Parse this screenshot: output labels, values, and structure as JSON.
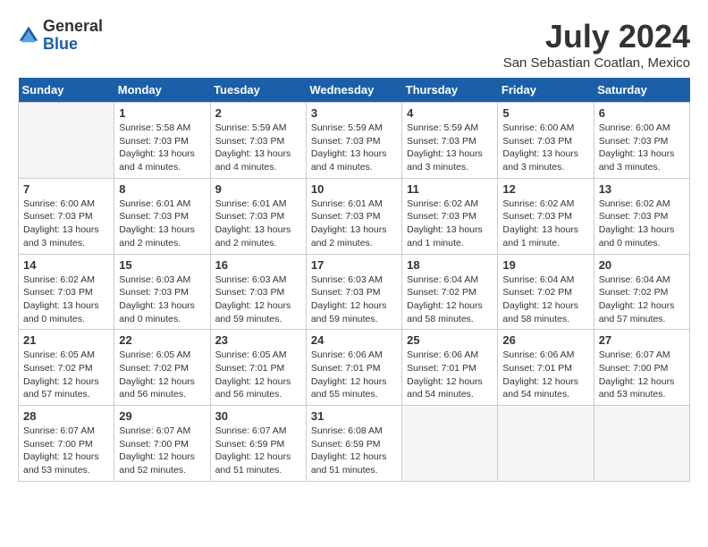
{
  "header": {
    "logo_general": "General",
    "logo_blue": "Blue",
    "month_title": "July 2024",
    "location": "San Sebastian Coatlan, Mexico"
  },
  "days_of_week": [
    "Sunday",
    "Monday",
    "Tuesday",
    "Wednesday",
    "Thursday",
    "Friday",
    "Saturday"
  ],
  "weeks": [
    [
      {
        "day": "",
        "empty": true
      },
      {
        "day": "1",
        "sunrise": "5:58 AM",
        "sunset": "7:03 PM",
        "daylight": "13 hours and 4 minutes."
      },
      {
        "day": "2",
        "sunrise": "5:59 AM",
        "sunset": "7:03 PM",
        "daylight": "13 hours and 4 minutes."
      },
      {
        "day": "3",
        "sunrise": "5:59 AM",
        "sunset": "7:03 PM",
        "daylight": "13 hours and 4 minutes."
      },
      {
        "day": "4",
        "sunrise": "5:59 AM",
        "sunset": "7:03 PM",
        "daylight": "13 hours and 3 minutes."
      },
      {
        "day": "5",
        "sunrise": "6:00 AM",
        "sunset": "7:03 PM",
        "daylight": "13 hours and 3 minutes."
      },
      {
        "day": "6",
        "sunrise": "6:00 AM",
        "sunset": "7:03 PM",
        "daylight": "13 hours and 3 minutes."
      }
    ],
    [
      {
        "day": "7",
        "sunrise": "6:00 AM",
        "sunset": "7:03 PM",
        "daylight": "13 hours and 3 minutes."
      },
      {
        "day": "8",
        "sunrise": "6:01 AM",
        "sunset": "7:03 PM",
        "daylight": "13 hours and 2 minutes."
      },
      {
        "day": "9",
        "sunrise": "6:01 AM",
        "sunset": "7:03 PM",
        "daylight": "13 hours and 2 minutes."
      },
      {
        "day": "10",
        "sunrise": "6:01 AM",
        "sunset": "7:03 PM",
        "daylight": "13 hours and 2 minutes."
      },
      {
        "day": "11",
        "sunrise": "6:02 AM",
        "sunset": "7:03 PM",
        "daylight": "13 hours and 1 minute."
      },
      {
        "day": "12",
        "sunrise": "6:02 AM",
        "sunset": "7:03 PM",
        "daylight": "13 hours and 1 minute."
      },
      {
        "day": "13",
        "sunrise": "6:02 AM",
        "sunset": "7:03 PM",
        "daylight": "13 hours and 0 minutes."
      }
    ],
    [
      {
        "day": "14",
        "sunrise": "6:02 AM",
        "sunset": "7:03 PM",
        "daylight": "13 hours and 0 minutes."
      },
      {
        "day": "15",
        "sunrise": "6:03 AM",
        "sunset": "7:03 PM",
        "daylight": "13 hours and 0 minutes."
      },
      {
        "day": "16",
        "sunrise": "6:03 AM",
        "sunset": "7:03 PM",
        "daylight": "12 hours and 59 minutes."
      },
      {
        "day": "17",
        "sunrise": "6:03 AM",
        "sunset": "7:03 PM",
        "daylight": "12 hours and 59 minutes."
      },
      {
        "day": "18",
        "sunrise": "6:04 AM",
        "sunset": "7:02 PM",
        "daylight": "12 hours and 58 minutes."
      },
      {
        "day": "19",
        "sunrise": "6:04 AM",
        "sunset": "7:02 PM",
        "daylight": "12 hours and 58 minutes."
      },
      {
        "day": "20",
        "sunrise": "6:04 AM",
        "sunset": "7:02 PM",
        "daylight": "12 hours and 57 minutes."
      }
    ],
    [
      {
        "day": "21",
        "sunrise": "6:05 AM",
        "sunset": "7:02 PM",
        "daylight": "12 hours and 57 minutes."
      },
      {
        "day": "22",
        "sunrise": "6:05 AM",
        "sunset": "7:02 PM",
        "daylight": "12 hours and 56 minutes."
      },
      {
        "day": "23",
        "sunrise": "6:05 AM",
        "sunset": "7:01 PM",
        "daylight": "12 hours and 56 minutes."
      },
      {
        "day": "24",
        "sunrise": "6:06 AM",
        "sunset": "7:01 PM",
        "daylight": "12 hours and 55 minutes."
      },
      {
        "day": "25",
        "sunrise": "6:06 AM",
        "sunset": "7:01 PM",
        "daylight": "12 hours and 54 minutes."
      },
      {
        "day": "26",
        "sunrise": "6:06 AM",
        "sunset": "7:01 PM",
        "daylight": "12 hours and 54 minutes."
      },
      {
        "day": "27",
        "sunrise": "6:07 AM",
        "sunset": "7:00 PM",
        "daylight": "12 hours and 53 minutes."
      }
    ],
    [
      {
        "day": "28",
        "sunrise": "6:07 AM",
        "sunset": "7:00 PM",
        "daylight": "12 hours and 53 minutes."
      },
      {
        "day": "29",
        "sunrise": "6:07 AM",
        "sunset": "7:00 PM",
        "daylight": "12 hours and 52 minutes."
      },
      {
        "day": "30",
        "sunrise": "6:07 AM",
        "sunset": "6:59 PM",
        "daylight": "12 hours and 51 minutes."
      },
      {
        "day": "31",
        "sunrise": "6:08 AM",
        "sunset": "6:59 PM",
        "daylight": "12 hours and 51 minutes."
      },
      {
        "day": "",
        "empty": true
      },
      {
        "day": "",
        "empty": true
      },
      {
        "day": "",
        "empty": true
      }
    ]
  ]
}
